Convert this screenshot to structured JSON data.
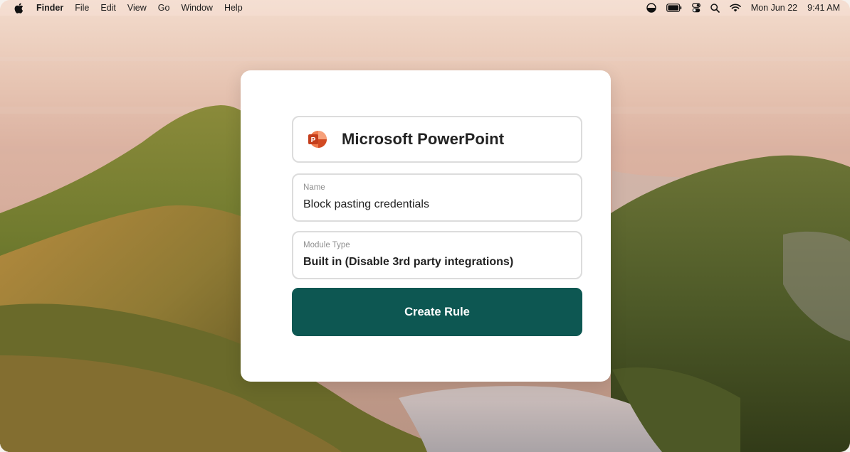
{
  "menubar": {
    "items": [
      "Finder",
      "File",
      "Edit",
      "View",
      "Go",
      "Window",
      "Help"
    ],
    "date": "Mon Jun 22",
    "time": "9:41 AM"
  },
  "card": {
    "app_name": "Microsoft PowerPoint",
    "app_icon": "powerpoint-icon",
    "name_field": {
      "label": "Name",
      "value": "Block pasting credentials"
    },
    "module_field": {
      "label": "Module Type",
      "value": "Built in (Disable 3rd party integrations)"
    },
    "button_label": "Create Rule"
  },
  "colors": {
    "button": "#0d5752",
    "powerpoint": "#e0582c",
    "card": "#ffffff"
  }
}
